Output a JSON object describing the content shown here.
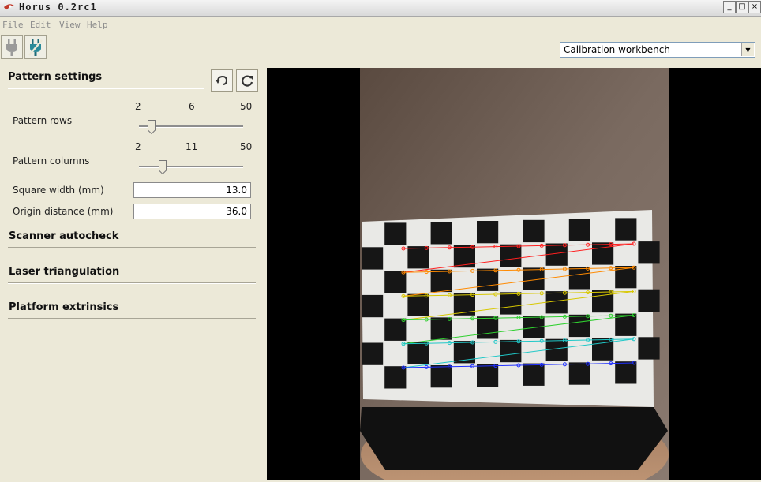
{
  "window": {
    "title": "Horus 0.2rc1",
    "minimize": "_",
    "maximize": "□",
    "close": "×"
  },
  "menu": [
    "File",
    "Edit",
    "View",
    "Help"
  ],
  "workbench_select": {
    "value": "Calibration workbench"
  },
  "sections": {
    "pattern_settings": "Pattern settings",
    "scanner_autocheck": "Scanner autocheck",
    "laser_triangulation": "Laser triangulation",
    "platform_extrinsics": "Platform extrinsics"
  },
  "pattern_rows": {
    "label": "Pattern rows",
    "min": "2",
    "value": "6",
    "max": "50",
    "fraction": 0.083
  },
  "pattern_columns": {
    "label": "Pattern columns",
    "min": "2",
    "value": "11",
    "max": "50",
    "fraction": 0.19
  },
  "square_width": {
    "label": "Square width (mm)",
    "value": "13.0"
  },
  "origin_distance": {
    "label": "Origin distance (mm)",
    "value": "36.0"
  },
  "icons": {
    "app": "horus-eye-icon",
    "connect": "plug-icon",
    "disconnect": "unplug-icon",
    "undo": "undo-icon",
    "refresh": "refresh-icon"
  },
  "colors": {
    "row_colors": [
      "#ff2020",
      "#ff8a00",
      "#d8c800",
      "#30d030",
      "#20c8c8",
      "#2030ff"
    ]
  }
}
